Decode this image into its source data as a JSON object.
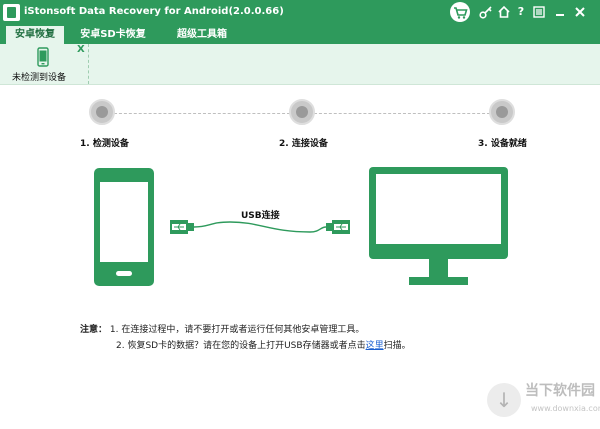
{
  "window": {
    "title": "iStonsoft Data Recovery for Android(2.0.0.66)"
  },
  "tabs": [
    {
      "label": "安卓恢复"
    },
    {
      "label": "安卓SD卡恢复"
    },
    {
      "label": "超级工具箱"
    }
  ],
  "device_bar": {
    "close_label": "X",
    "status_label": "未检测到设备"
  },
  "steps": [
    {
      "label": "1. 检测设备"
    },
    {
      "label": "2. 连接设备"
    },
    {
      "label": "3. 设备就绪"
    }
  ],
  "cable": {
    "label": "USB连接"
  },
  "notes": {
    "heading": "注意：",
    "item1": "1. 在连接过程中，请不要打开或者运行任何其他安卓管理工具。",
    "item2_prefix": "2. 恢复SD卡的数据？请在您的设备上打开USB存储器或者点击",
    "item2_link": "这里",
    "item2_suffix": "扫描。"
  },
  "watermark": {
    "name": "当下软件园",
    "url": "www.downxia.com"
  },
  "colors": {
    "brand_green": "#2e9a5c",
    "light_green": "#e6f5ec",
    "step_gray": "#c9c9c9",
    "link_blue": "#1a5fd0"
  },
  "icons": [
    "app-logo-icon",
    "cart-icon",
    "key-icon",
    "home-icon",
    "help-icon",
    "menu-icon",
    "minimize-icon",
    "close-icon",
    "phone-icon",
    "usb-icon",
    "monitor-icon"
  ]
}
